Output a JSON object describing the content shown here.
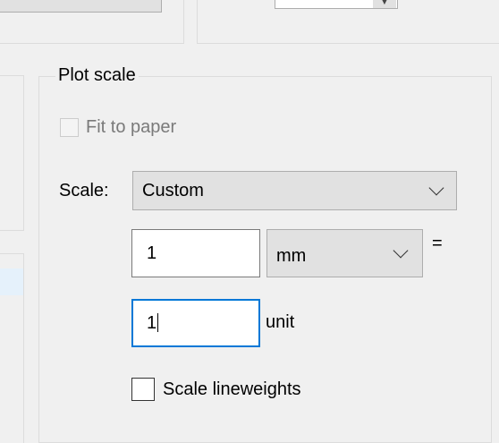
{
  "plot_scale": {
    "title": "Plot scale",
    "fit_to_paper": {
      "label": "Fit to paper",
      "checked": false,
      "enabled": false
    },
    "scale": {
      "label": "Scale:",
      "selected": "Custom"
    },
    "paper_value": "1",
    "paper_units": "mm",
    "equals": "=",
    "drawing_value": "1",
    "drawing_units_label": "unit",
    "scale_lineweights": {
      "label": "Scale lineweights",
      "checked": false
    }
  },
  "colors": {
    "dialog_background": "#f0f0f0",
    "focus_border": "#0078d7",
    "disabled_text": "#7a7a7a",
    "left_highlight": "#e5f1fb"
  },
  "icons": {
    "dropdown": "chevron-down-icon",
    "paper-count-arrow": "triangle-down-icon"
  }
}
